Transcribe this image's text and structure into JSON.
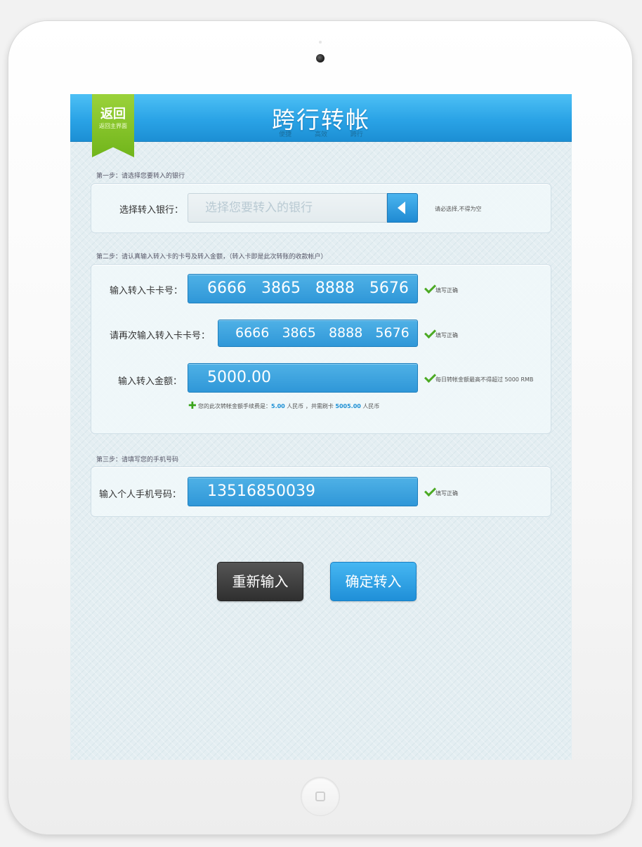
{
  "header": {
    "title": "跨行转帐",
    "subtitle": "便捷 高效 跨行",
    "back_label": "返回",
    "back_sub": "返回主界面"
  },
  "step1": {
    "label": "第一步：请选择您要转入的银行",
    "field_label": "选择转入银行：",
    "placeholder": "选择您要转入的银行",
    "hint": "请必选择,不得为空"
  },
  "step2": {
    "label": "第二步：请认真输入转入卡的卡号及转入金额，（转入卡即是此次转账的收款帐户）",
    "card_label": "输入转入卡卡号：",
    "card_value": "6666   3865   8888   5676",
    "card_hint": "填写正确",
    "confirm_label": "请再次输入转入卡卡号：",
    "confirm_value": "6666   3865   8888   5676",
    "confirm_hint": "填写正确",
    "amount_label": "输入转入金额：",
    "amount_value": "5000.00",
    "amount_hint": "每日转帐金额最高不得超过 5000 RMB",
    "fee_text_1": "您的此次转帐金额手续费是：",
    "fee_amount": "5.00",
    "fee_text_2": " 人民币 ，共需刷卡 ",
    "total_amount": "5005.00",
    "fee_text_3": " 人民币"
  },
  "step3": {
    "label": "第三步：请填写您的手机号码",
    "phone_label": "输入个人手机号码：",
    "phone_value": "13516850039",
    "phone_hint": "填写正确"
  },
  "buttons": {
    "reset": "重新输入",
    "confirm": "确定转入"
  },
  "colors": {
    "accent": "#2aa3e6",
    "ribbon": "#84c42a",
    "success": "#4caa24"
  }
}
